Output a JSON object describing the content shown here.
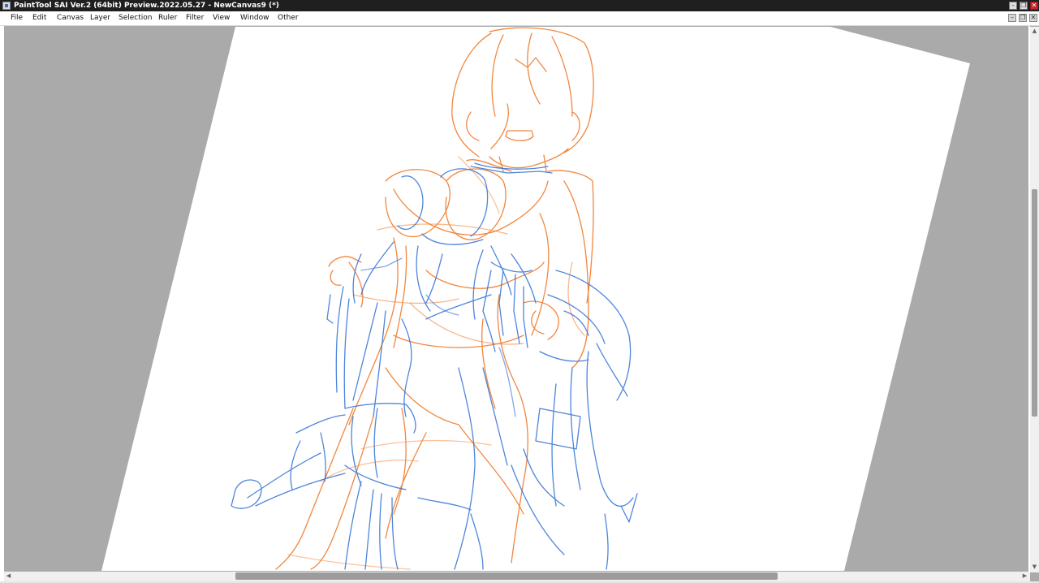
{
  "window": {
    "title": "PaintTool SAI Ver.2 (64bit) Preview.2022.05.27 - NewCanvas9 (*)",
    "minimize_glyph": "–",
    "restore_glyph": "❐",
    "close_glyph": "✕"
  },
  "menu": {
    "items": [
      {
        "label": "File"
      },
      {
        "label": "Edit"
      },
      {
        "label": "Canvas"
      },
      {
        "label": "Layer"
      },
      {
        "label": "Selection"
      },
      {
        "label": "Ruler"
      },
      {
        "label": "Filter"
      },
      {
        "label": "View"
      },
      {
        "label": "Window"
      },
      {
        "label": "Other"
      }
    ],
    "doc_minimize_glyph": "–",
    "doc_restore_glyph": "❐",
    "doc_close_glyph": "✕"
  },
  "scrollbars": {
    "up_glyph": "▲",
    "down_glyph": "▼",
    "left_glyph": "◀",
    "right_glyph": "▶"
  },
  "colors": {
    "titlebar": "#1f1f1f",
    "workspace": "#aaaaaa",
    "paper": "#ffffff",
    "sketch_orange": "#f07a2a",
    "sketch_blue": "#3a78d8",
    "close_button": "#c8282d"
  },
  "icons": {
    "app": "painttool-sai-icon",
    "minimize": "minimize-icon",
    "restore": "restore-icon",
    "close": "close-icon"
  }
}
